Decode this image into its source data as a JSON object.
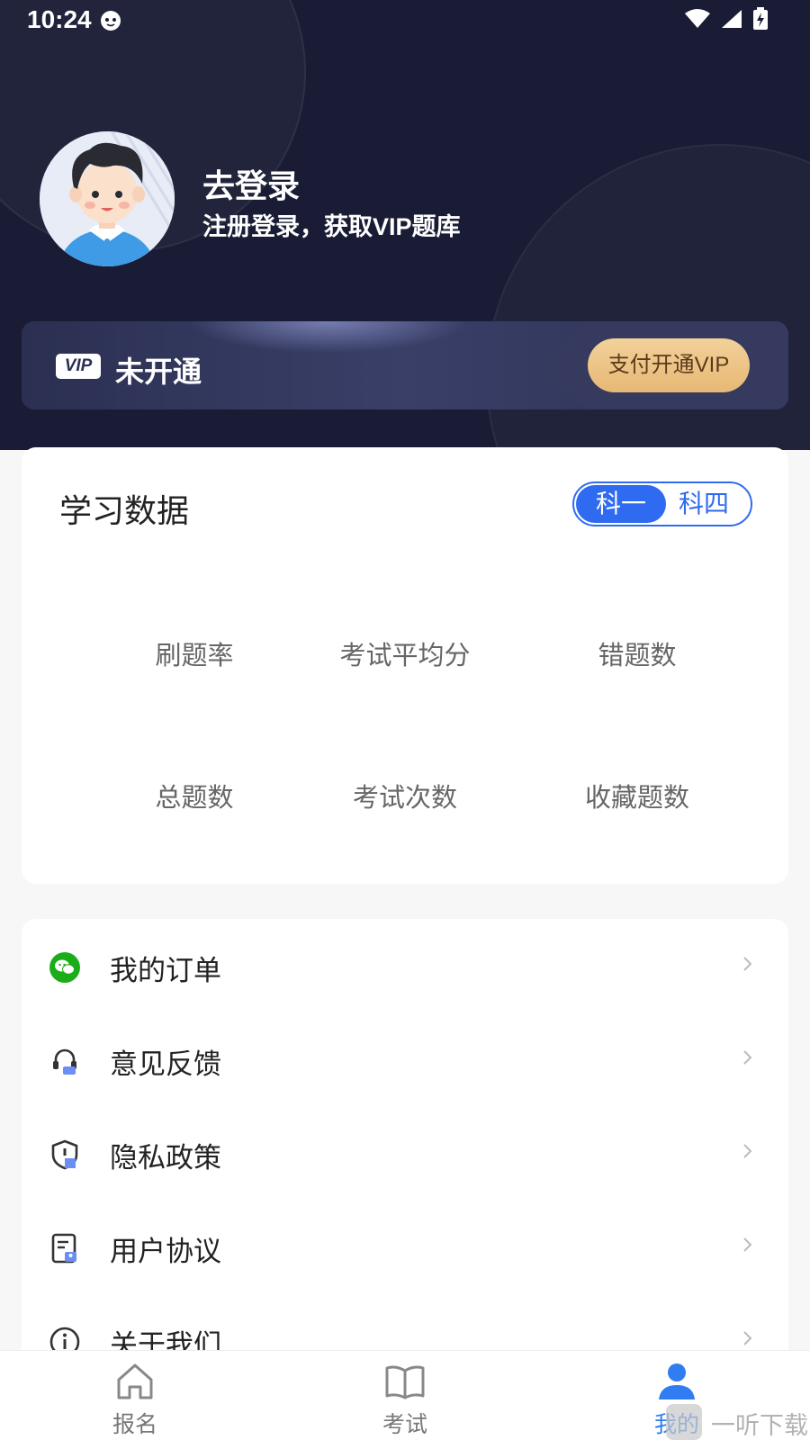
{
  "status_bar": {
    "time": "10:24"
  },
  "profile": {
    "title": "去登录",
    "subtitle": "注册登录，获取VIP题库"
  },
  "vip": {
    "badge": "VIP",
    "status": "未开通",
    "button_label": "支付开通VIP"
  },
  "study": {
    "title": "学习数据",
    "toggle": {
      "selected": "科一",
      "other": "科四"
    },
    "stats": [
      "刷题率",
      "考试平均分",
      "错题数",
      "总题数",
      "考试次数",
      "收藏题数"
    ]
  },
  "menu": {
    "items": [
      {
        "label": "我的订单",
        "icon": "wechat-icon"
      },
      {
        "label": "意见反馈",
        "icon": "headset-icon"
      },
      {
        "label": "隐私政策",
        "icon": "shield-icon"
      },
      {
        "label": "用户协议",
        "icon": "document-icon"
      },
      {
        "label": "关于我们",
        "icon": "info-icon"
      }
    ]
  },
  "tabbar": {
    "items": [
      {
        "label": "报名",
        "icon": "home-icon"
      },
      {
        "label": "考试",
        "icon": "book-icon"
      },
      {
        "label": "我的",
        "icon": "user-icon",
        "active": true
      }
    ]
  },
  "watermark": {
    "text": "一听下载"
  },
  "colors": {
    "accent": "#2f6bf0",
    "header_bg": "#191c34",
    "vip_button": "#e7b875"
  }
}
